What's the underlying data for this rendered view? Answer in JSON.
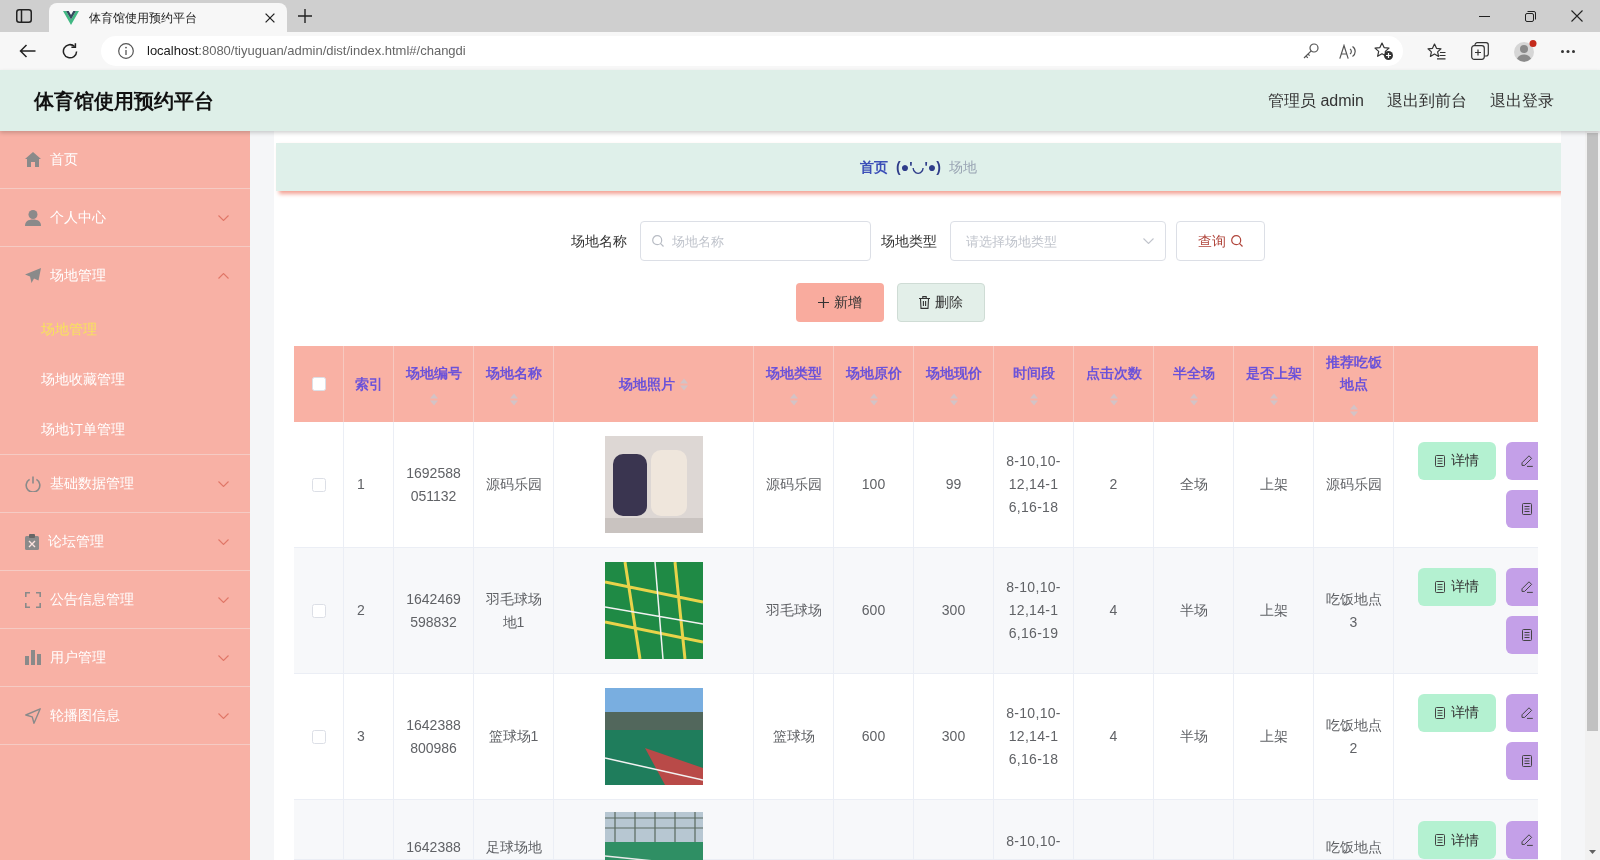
{
  "browser": {
    "tab": {
      "title": "体育馆使用预约平台"
    },
    "address": {
      "host": "localhost",
      "path": ":8080/tiyuguan/admin/dist/index.html#/changdi"
    }
  },
  "header": {
    "title": "体育馆使用预约平台",
    "links": [
      "管理员 admin",
      "退出到前台",
      "退出登录"
    ]
  },
  "sidebar": {
    "items": [
      {
        "label": "首页",
        "kind": "link"
      },
      {
        "label": "个人中心",
        "kind": "menu",
        "expanded": false
      },
      {
        "label": "场地管理",
        "kind": "menu",
        "expanded": true,
        "children": [
          {
            "label": "场地管理",
            "selected": true
          },
          {
            "label": "场地收藏管理",
            "selected": false
          },
          {
            "label": "场地订单管理",
            "selected": false
          }
        ]
      },
      {
        "label": "基础数据管理",
        "kind": "menu",
        "expanded": false
      },
      {
        "label": "论坛管理",
        "kind": "menu",
        "expanded": false
      },
      {
        "label": "公告信息管理",
        "kind": "menu",
        "expanded": false
      },
      {
        "label": "用户管理",
        "kind": "menu",
        "expanded": false
      },
      {
        "label": "轮播图信息",
        "kind": "menu",
        "expanded": false
      }
    ]
  },
  "breadcrumb": {
    "items": [
      "首页",
      "场地"
    ],
    "separator": "(●'◡'●)"
  },
  "filters": [
    {
      "label": "场地名称",
      "kind": "input",
      "placeholder": "场地名称"
    },
    {
      "label": "场地类型",
      "kind": "select",
      "placeholder": "请选择场地类型"
    }
  ],
  "search_button": "查询",
  "toolbar": [
    {
      "kind": "add",
      "label": "新增"
    },
    {
      "kind": "delete",
      "label": "删除"
    }
  ],
  "table": {
    "select_all": {
      "checked": false
    },
    "columns": [
      {
        "label": "索引",
        "sortable": false
      },
      {
        "label": "场地编号",
        "sortable": true
      },
      {
        "label": "场地名称",
        "sortable": true
      },
      {
        "label": "场地照片",
        "sortable": true
      },
      {
        "label": "场地类型",
        "sortable": true
      },
      {
        "label": "场地原价",
        "sortable": true
      },
      {
        "label": "场地现价",
        "sortable": true
      },
      {
        "label": "时间段",
        "sortable": true
      },
      {
        "label": "点击次数",
        "sortable": true
      },
      {
        "label": "半全场",
        "sortable": true
      },
      {
        "label": "是否上架",
        "sortable": true
      },
      {
        "label": "推荐吃饭地点",
        "sortable": true
      }
    ],
    "rows": [
      {
        "checked": false,
        "index": "1",
        "code": "1692588051132",
        "name": "源码乐园",
        "type": "源码乐园",
        "original_price": "100",
        "current_price": "99",
        "time_slots": "8-10,10-12,14-16,16-18",
        "clicks": "2",
        "court": "全场",
        "listed": "上架",
        "restaurant": "源码乐园",
        "actions": [
          {
            "kind": "detail",
            "label": "详情"
          },
          {
            "kind": "edit"
          },
          {
            "kind": "document"
          }
        ]
      },
      {
        "checked": false,
        "index": "2",
        "code": "1642469598832",
        "name": "羽毛球场地1",
        "type": "羽毛球场",
        "original_price": "600",
        "current_price": "300",
        "time_slots": "8-10,10-12,14-16,16-19",
        "clicks": "4",
        "court": "半场",
        "listed": "上架",
        "restaurant": "吃饭地点3",
        "actions": [
          {
            "kind": "detail",
            "label": "详情"
          },
          {
            "kind": "edit"
          },
          {
            "kind": "document"
          }
        ]
      },
      {
        "checked": false,
        "index": "3",
        "code": "1642388800986",
        "name": "篮球场1",
        "type": "篮球场",
        "original_price": "600",
        "current_price": "300",
        "time_slots": "8-10,10-12,14-16,16-18",
        "clicks": "4",
        "court": "半场",
        "listed": "上架",
        "restaurant": "吃饭地点2",
        "actions": [
          {
            "kind": "detail",
            "label": "详情"
          },
          {
            "kind": "edit"
          },
          {
            "kind": "document"
          }
        ]
      },
      {
        "code": "1642388",
        "name": "足球场地",
        "time_slots": "8-10,10-",
        "restaurant": "吃饭地点",
        "actions": [
          {
            "kind": "detail",
            "label": "详情"
          },
          {
            "kind": "edit"
          }
        ]
      }
    ]
  }
}
